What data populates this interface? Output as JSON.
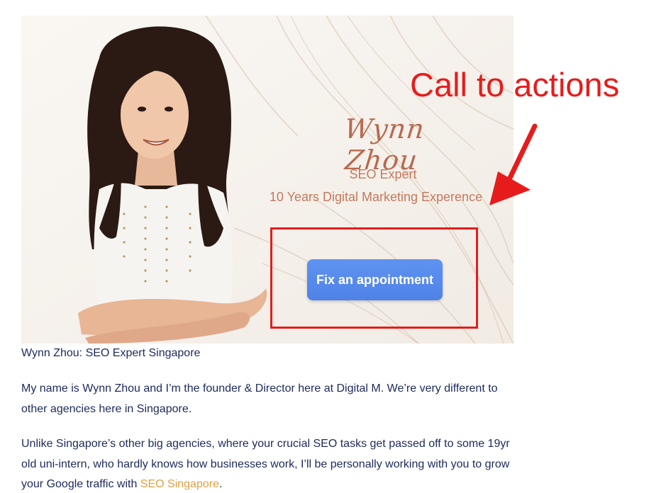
{
  "hero": {
    "name": "Wynn Zhou",
    "role": "SEO Expert",
    "experience": "10 Years Digital Marketing Experence",
    "cta_label": "Fix an appointment"
  },
  "annotation": {
    "label": "Call to actions",
    "color": "#e61c1c"
  },
  "caption": "Wynn Zhou: SEO Expert Singapore",
  "paragraph1": "My name is Wynn Zhou and I’m the founder & Director here at Digital M. We’re very different to other agencies here in Singapore.",
  "paragraph2": {
    "text": "Unlike Singapore’s other big agencies, where your crucial SEO tasks get passed off to some 19yr old uni-intern, who hardly knows how businesses work, I’ll be personally working with you to grow your Google traffic with ",
    "link_text": "SEO Singapore",
    "end": "."
  },
  "colors": {
    "body_text": "#1d2a5a",
    "link": "#e0a040",
    "cta_button": "#5b8ef0",
    "hero_accent": "#c27a5e"
  }
}
